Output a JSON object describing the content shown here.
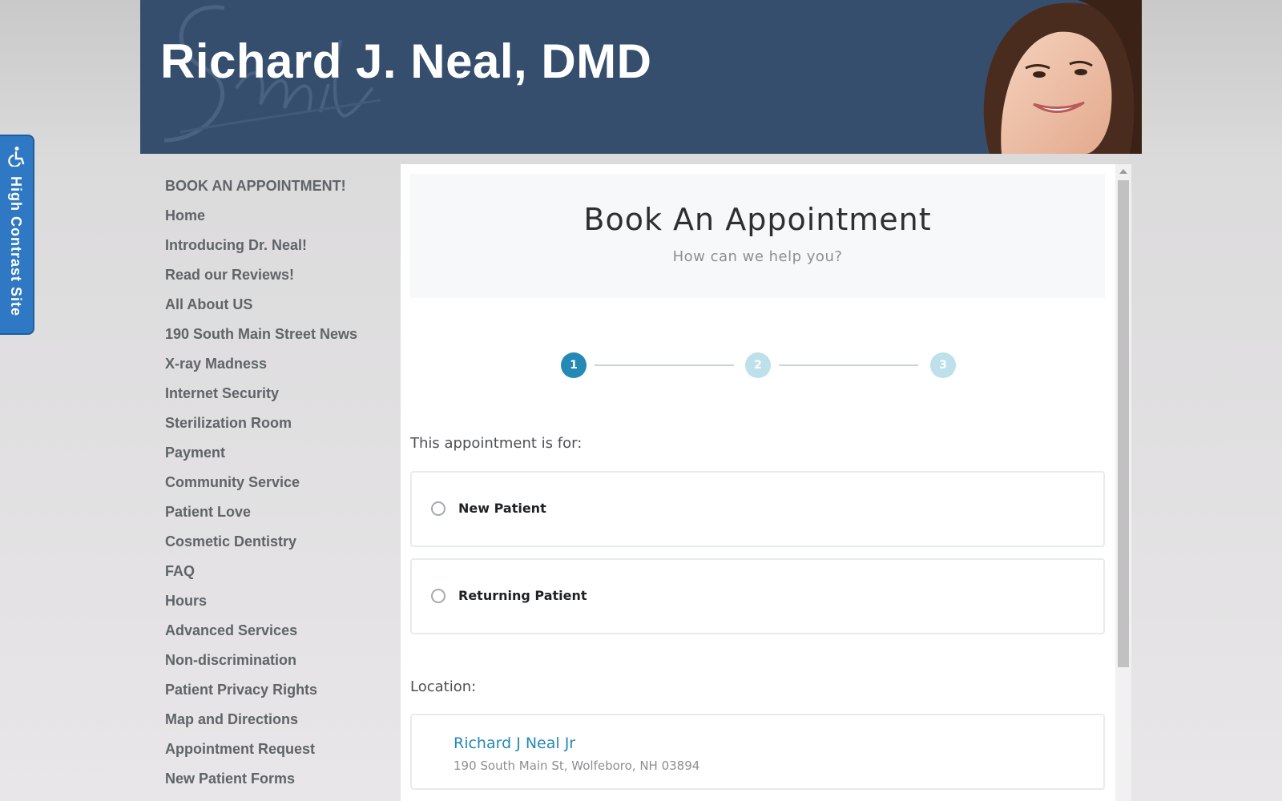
{
  "header": {
    "title": "Richard J. Neal, DMD",
    "background_color": "#364e6d"
  },
  "accessibility": {
    "label": "High Contrast Site",
    "icon": "wheelchair-icon",
    "color": "#2f79c4"
  },
  "sidebar": {
    "items": [
      {
        "label": "BOOK AN APPOINTMENT!"
      },
      {
        "label": "Home"
      },
      {
        "label": "Introducing Dr. Neal!"
      },
      {
        "label": "Read our Reviews!"
      },
      {
        "label": "All About US"
      },
      {
        "label": "190 South Main Street News"
      },
      {
        "label": "X-ray Madness"
      },
      {
        "label": "Internet Security"
      },
      {
        "label": "Sterilization Room"
      },
      {
        "label": "Payment"
      },
      {
        "label": "Community Service"
      },
      {
        "label": "Patient Love"
      },
      {
        "label": "Cosmetic Dentistry"
      },
      {
        "label": "FAQ"
      },
      {
        "label": "Hours"
      },
      {
        "label": "Advanced Services"
      },
      {
        "label": "Non-discrimination"
      },
      {
        "label": "Patient Privacy Rights"
      },
      {
        "label": "Map and Directions"
      },
      {
        "label": "Appointment Request"
      },
      {
        "label": "New Patient Forms"
      }
    ]
  },
  "booking": {
    "title": "Book An Appointment",
    "subtitle": "How can we help you?",
    "steps": [
      "1",
      "2",
      "3"
    ],
    "current_step": 1,
    "appointment_for_label": "This appointment is for:",
    "options": [
      {
        "label": "New Patient",
        "selected": false
      },
      {
        "label": "Returning Patient",
        "selected": false
      }
    ],
    "location_label": "Location:",
    "location": {
      "name": "Richard J Neal Jr",
      "address": "190 South Main St, Wolfeboro, NH 03894"
    },
    "accent_color": "#2489b5"
  }
}
